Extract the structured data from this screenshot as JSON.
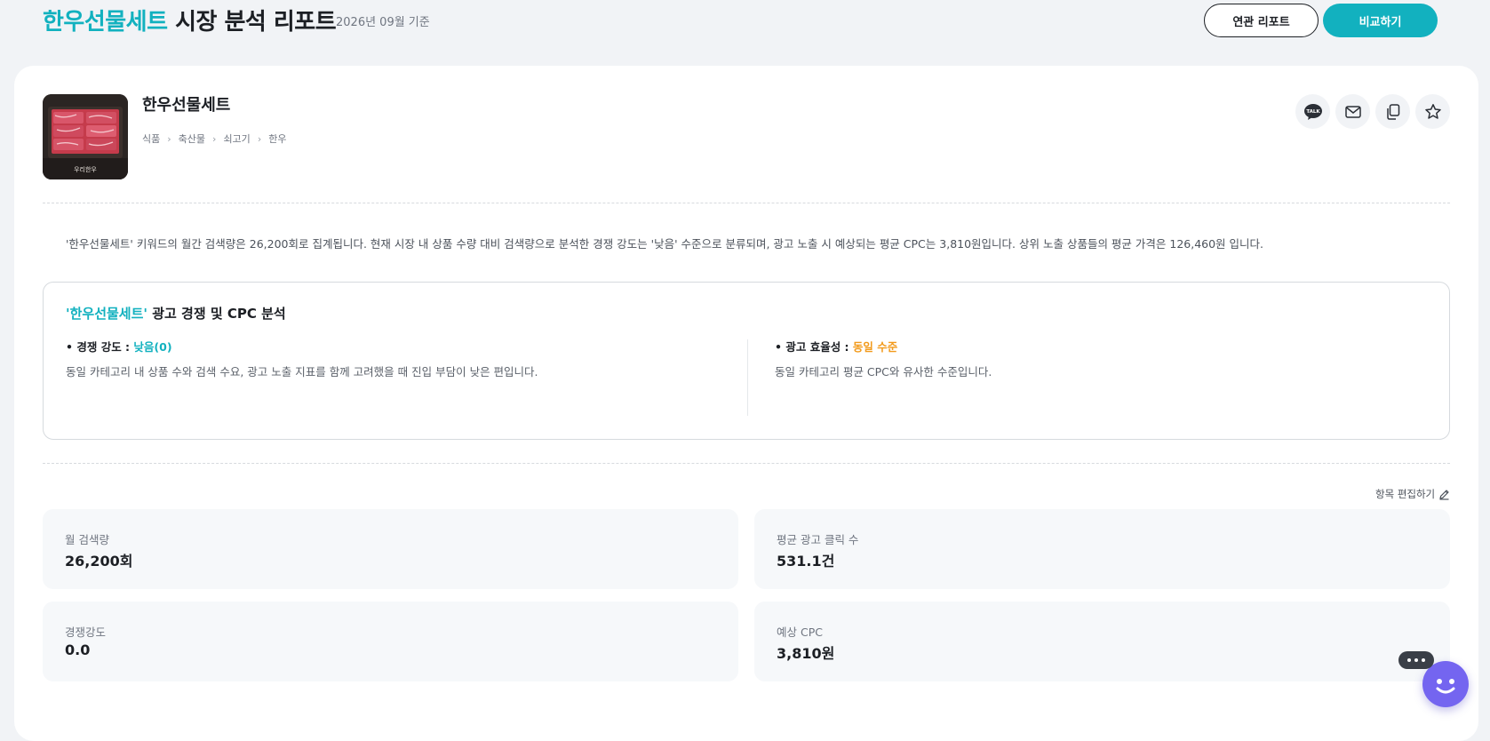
{
  "header": {
    "keyword": "한우선물세트",
    "title_suffix": " 시장 분석 리포트",
    "date_note": "2026년 09월 기준",
    "related_button": "연관 리포트",
    "compare_button": "비교하기"
  },
  "product": {
    "name": "한우선물세트",
    "breadcrumb": [
      "식품",
      "축산물",
      "쇠고기",
      "한우"
    ],
    "image_caption": "우리한우",
    "actions": [
      "kakao-talk-icon",
      "mail-icon",
      "copy-icon",
      "star-icon"
    ],
    "kakao_label": "TALK"
  },
  "summary": "'한우선물세트' 키워드의 월간 검색량은 26,200회로 집계됩니다. 현재 시장 내 상품 수량 대비 검색량으로 분석한 경쟁 강도는 '낮음' 수준으로 분류되며, 광고 노출 시 예상되는 평균 CPC는 3,810원입니다. 상위 노출 상품들의 평균 가격은 126,460원 입니다.",
  "analysis": {
    "title_keyword": "'한우선물세트'",
    "title_suffix": " 광고 경쟁 및 CPC 분석",
    "competition": {
      "label": "• 경쟁 강도 : ",
      "value": "낮음(0)",
      "description": "동일 카테고리 내 상품 수와 검색 수요, 광고 노출 지표를 함께 고려했을 때 진입 부담이 낮은 편입니다."
    },
    "efficiency": {
      "label": "• 광고 효율성 : ",
      "value": "동일 수준",
      "description": "동일 카테고리 평균 CPC와 유사한 수준입니다."
    }
  },
  "edit_label": "항목 편집하기",
  "metrics": [
    {
      "label": "월 검색량",
      "value": "26,200회"
    },
    {
      "label": "평균 광고 클릭 수",
      "value": "531.1건"
    },
    {
      "label": "경쟁강도",
      "value": "0.0"
    },
    {
      "label": "예상 CPC",
      "value": "3,810원"
    }
  ],
  "colors": {
    "accent": "#12b1bf",
    "warning": "#f29a1b",
    "chatbot": "#7465f0"
  }
}
